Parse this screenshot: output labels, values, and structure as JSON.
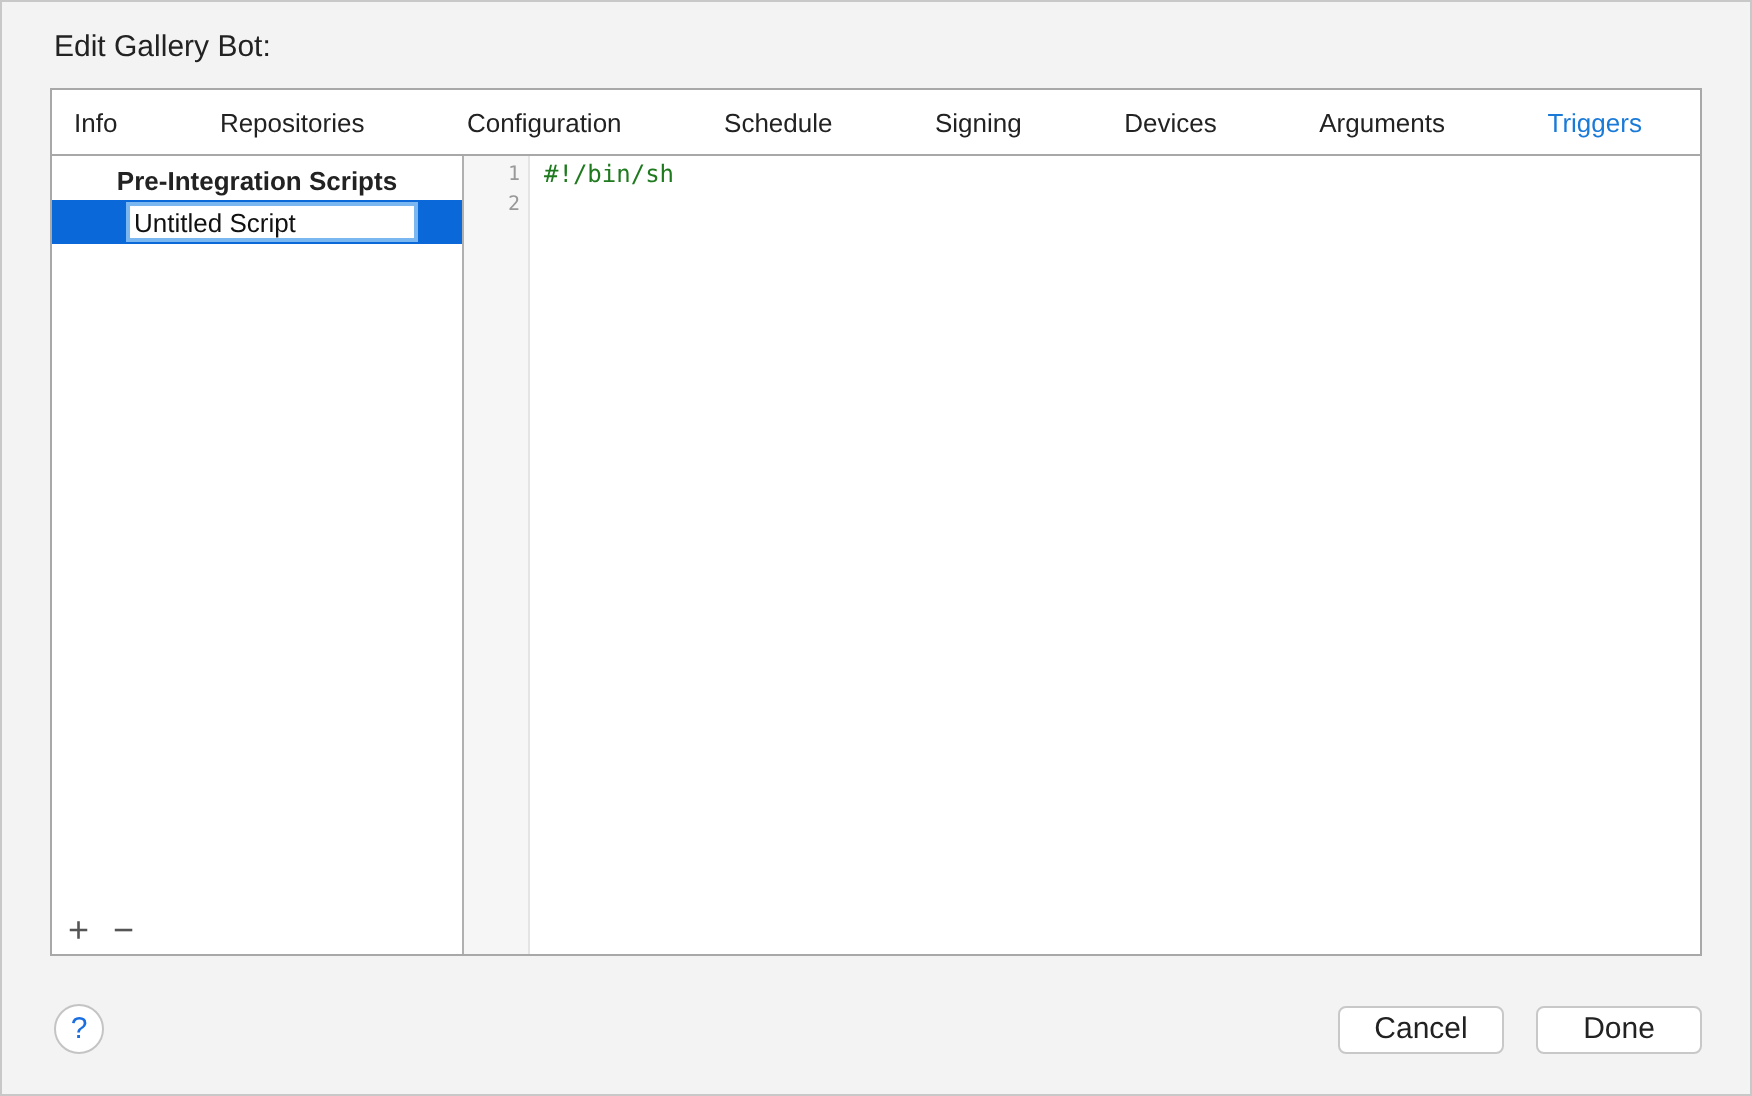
{
  "window": {
    "title": "Edit Gallery Bot:"
  },
  "tabs": [
    {
      "label": "Info",
      "selected": false
    },
    {
      "label": "Repositories",
      "selected": false
    },
    {
      "label": "Configuration",
      "selected": false
    },
    {
      "label": "Schedule",
      "selected": false
    },
    {
      "label": "Signing",
      "selected": false
    },
    {
      "label": "Devices",
      "selected": false
    },
    {
      "label": "Arguments",
      "selected": false
    },
    {
      "label": "Triggers",
      "selected": true
    }
  ],
  "sidebar": {
    "heading": "Pre-Integration Scripts",
    "items": [
      {
        "value": "Untitled Script",
        "selected": true
      }
    ],
    "add_button": "+",
    "remove_button": "−"
  },
  "editor": {
    "lines": [
      {
        "number": "1",
        "code": "#!/bin/sh"
      },
      {
        "number": "2"
      }
    ]
  },
  "help_button": "?",
  "buttons": [
    "Cancel",
    "Done"
  ]
}
